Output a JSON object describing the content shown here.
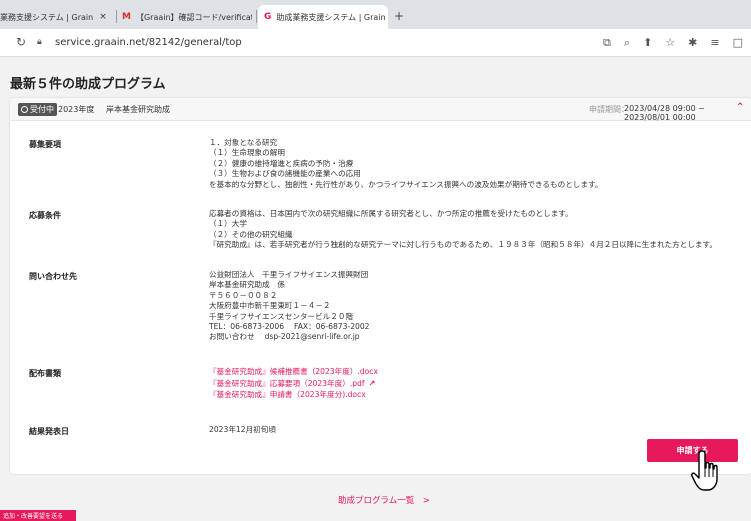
{
  "browser": {
    "tabs": [
      {
        "label": "業務支援システム | Grain",
        "icon": "grain-favicon",
        "color": "#e6195c"
      },
      {
        "label": "【Graain】確認コード/verificati",
        "icon": "gmail-favicon",
        "color": "#d93025"
      },
      {
        "label": "助成業務支援システム | Grain",
        "icon": "grain-favicon",
        "color": "#e6195c"
      }
    ],
    "close_glyph": "×",
    "new_tab_glyph": "+",
    "url": "service.graain.net/82142/general/top"
  },
  "page": {
    "title": "最新５件の助成プログラム",
    "program": {
      "status": "受付中",
      "fiscal_year": "2023年度",
      "name": "岸本基金研究助成",
      "period_label": "申請期間：",
      "period": "2023/04/28 09:00 ~ 2023/08/01 00:00"
    },
    "sections": {
      "recruit": {
        "label": "募集要項",
        "lines": [
          "１．対象となる研究",
          "（１）生命現象の解明",
          "（２）健康の維持増進と疾病の予防・治療",
          "（３）生物および食の諸機能の産業への応用",
          "を基本的な分野とし、独創性・先行性があり、かつライフサイエンス振興への波及効果が期待できるものとします。"
        ]
      },
      "requirements": {
        "label": "応募条件",
        "lines": [
          "応募者の資格は、日本国内で次の研究組織に所属する研究者とし、かつ所定の推薦を受けたものとします。",
          "（１）大学",
          "（２）その他の研究組織",
          "『研究助成』は、若手研究者が行う独創的な研究テーマに対し行うものであるため、１９８３年（昭和５８年）４月２日以降に生まれた方とします。"
        ]
      },
      "contact": {
        "label": "問い合わせ先",
        "lines": [
          "公益財団法人　千里ライフサイエンス振興財団",
          "岸本基金研究助成　係",
          "〒５６０－００８２",
          "大阪府豊中市新千里東町１－４－２",
          "千里ライフサイエンスセンタービル２０階",
          "TEL：06-6873-2006　 FAX：06-6873-2002",
          "お問い合わせ　 dsp-2021@senri-life.or.jp"
        ]
      },
      "documents": {
        "label": "配布書類",
        "files": [
          "『基金研究助成』候補推薦書（2023年度）.docx",
          "『基金研究助成』応募要項（2023年度）.pdf",
          "『基金研究助成』申請書（2023年度分).docx"
        ]
      },
      "announcement": {
        "label": "結果発表日",
        "value": "2023年12月初旬頃"
      }
    },
    "apply_button": "申請する",
    "list_link": "助成プログラム一覧　>",
    "feedback_button": "追加・改善要望を送る"
  },
  "colors": {
    "accent": "#e6195c"
  }
}
